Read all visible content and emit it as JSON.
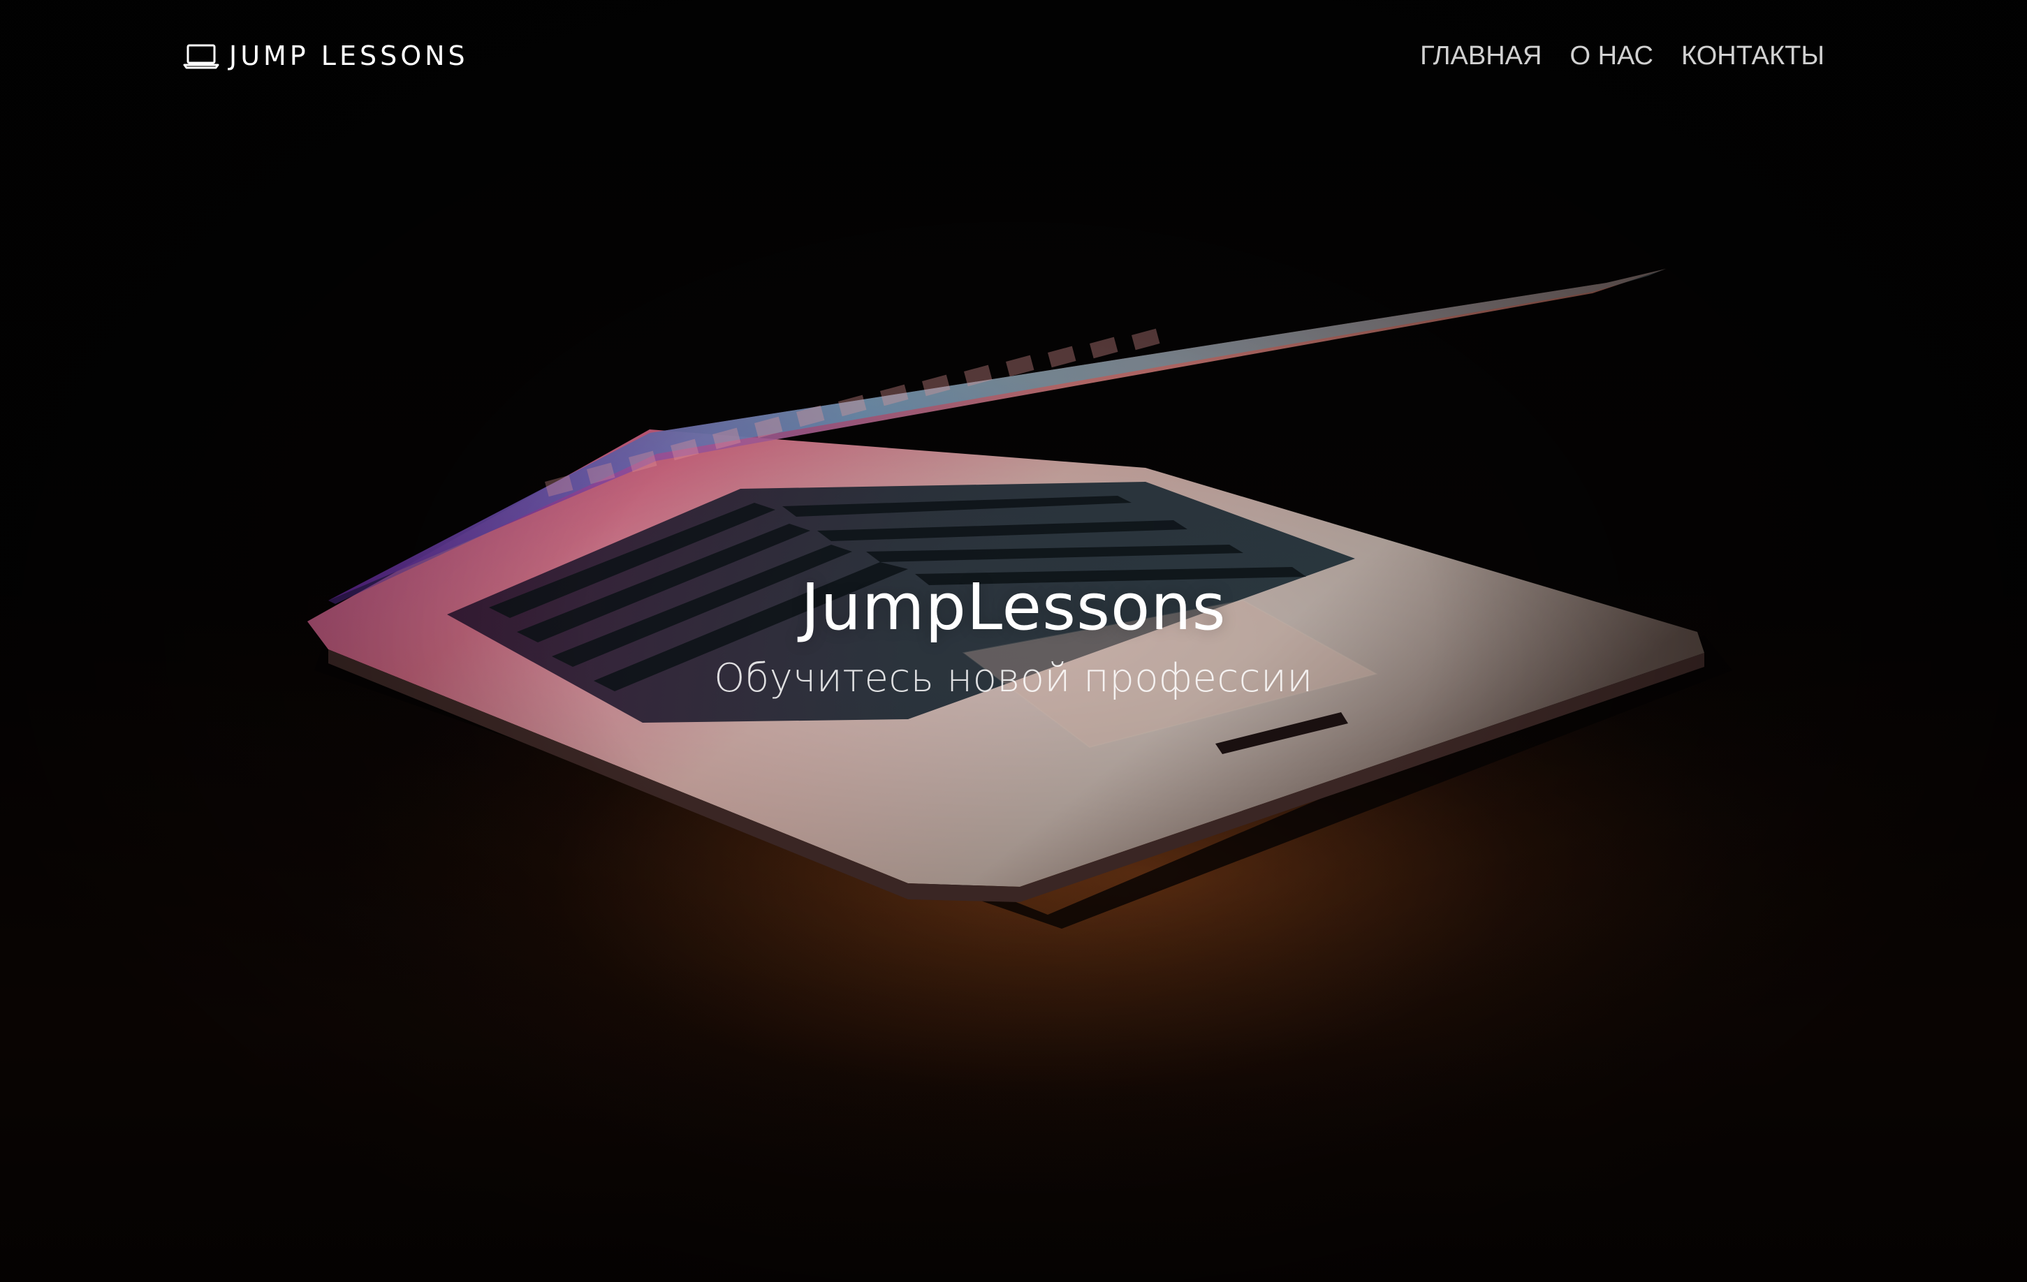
{
  "brand": {
    "name": "JUMP LESSONS",
    "icon": "laptop-icon"
  },
  "nav": {
    "items": [
      {
        "label": "ГЛАВНАЯ"
      },
      {
        "label": "О НАС"
      },
      {
        "label": "КОНТАКТЫ"
      }
    ]
  },
  "hero": {
    "title": "JumpLessons",
    "subtitle": "Обучитесь новой профессии",
    "background": "laptop-photo",
    "colors": {
      "text": "#ffffff",
      "background": "#000000"
    }
  }
}
